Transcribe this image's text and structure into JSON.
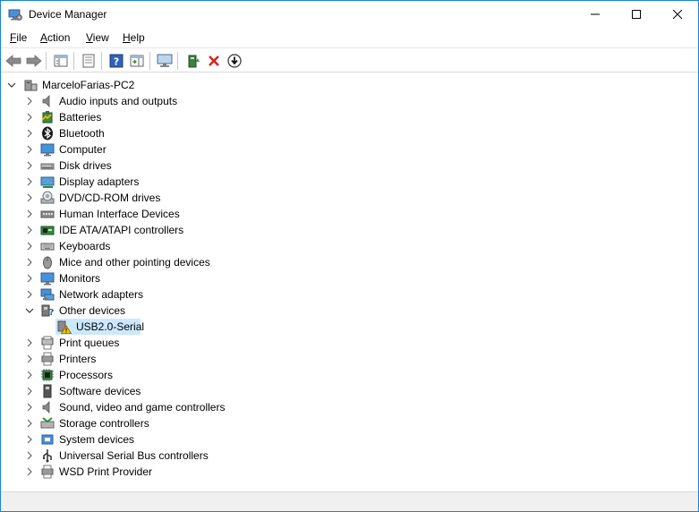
{
  "window": {
    "title": "Device Manager"
  },
  "menu": [
    {
      "underline": "F",
      "rest": "ile"
    },
    {
      "underline": "A",
      "rest": "ction"
    },
    {
      "underline": "V",
      "rest": "iew"
    },
    {
      "underline": "H",
      "rest": "elp"
    }
  ],
  "tree": {
    "root": "MarceloFarias-PC2",
    "categories": [
      {
        "label": "Audio inputs and outputs",
        "icon": "speaker-icon",
        "expanded": false
      },
      {
        "label": "Batteries",
        "icon": "battery-icon",
        "expanded": false
      },
      {
        "label": "Bluetooth",
        "icon": "bluetooth-icon",
        "expanded": false
      },
      {
        "label": "Computer",
        "icon": "computer-icon",
        "expanded": false
      },
      {
        "label": "Disk drives",
        "icon": "disk-drive-icon",
        "expanded": false
      },
      {
        "label": "Display adapters",
        "icon": "display-adapter-icon",
        "expanded": false
      },
      {
        "label": "DVD/CD-ROM drives",
        "icon": "dvd-drive-icon",
        "expanded": false
      },
      {
        "label": "Human Interface Devices",
        "icon": "hid-icon",
        "expanded": false
      },
      {
        "label": "IDE ATA/ATAPI controllers",
        "icon": "ide-controller-icon",
        "expanded": false
      },
      {
        "label": "Keyboards",
        "icon": "keyboard-icon",
        "expanded": false
      },
      {
        "label": "Mice and other pointing devices",
        "icon": "mouse-icon",
        "expanded": false
      },
      {
        "label": "Monitors",
        "icon": "monitor-icon",
        "expanded": false
      },
      {
        "label": "Network adapters",
        "icon": "network-adapter-icon",
        "expanded": false
      },
      {
        "label": "Other devices",
        "icon": "other-devices-icon",
        "expanded": true
      },
      {
        "label": "USB2.0-Serial",
        "icon": "warning-device-icon",
        "child": true,
        "selected": true
      },
      {
        "label": "Print queues",
        "icon": "print-queue-icon",
        "expanded": false
      },
      {
        "label": "Printers",
        "icon": "printer-icon",
        "expanded": false
      },
      {
        "label": "Processors",
        "icon": "processor-icon",
        "expanded": false
      },
      {
        "label": "Software devices",
        "icon": "software-device-icon",
        "expanded": false
      },
      {
        "label": "Sound, video and game controllers",
        "icon": "sound-controller-icon",
        "expanded": false
      },
      {
        "label": "Storage controllers",
        "icon": "storage-controller-icon",
        "expanded": false
      },
      {
        "label": "System devices",
        "icon": "system-devices-icon",
        "expanded": false
      },
      {
        "label": "Universal Serial Bus controllers",
        "icon": "usb-icon",
        "expanded": false
      },
      {
        "label": "WSD Print Provider",
        "icon": "wsd-print-icon",
        "expanded": false
      }
    ]
  },
  "colors": {
    "selection": "#cce8ff",
    "accent": "#1883d7",
    "remove_x": "#d9251d"
  }
}
